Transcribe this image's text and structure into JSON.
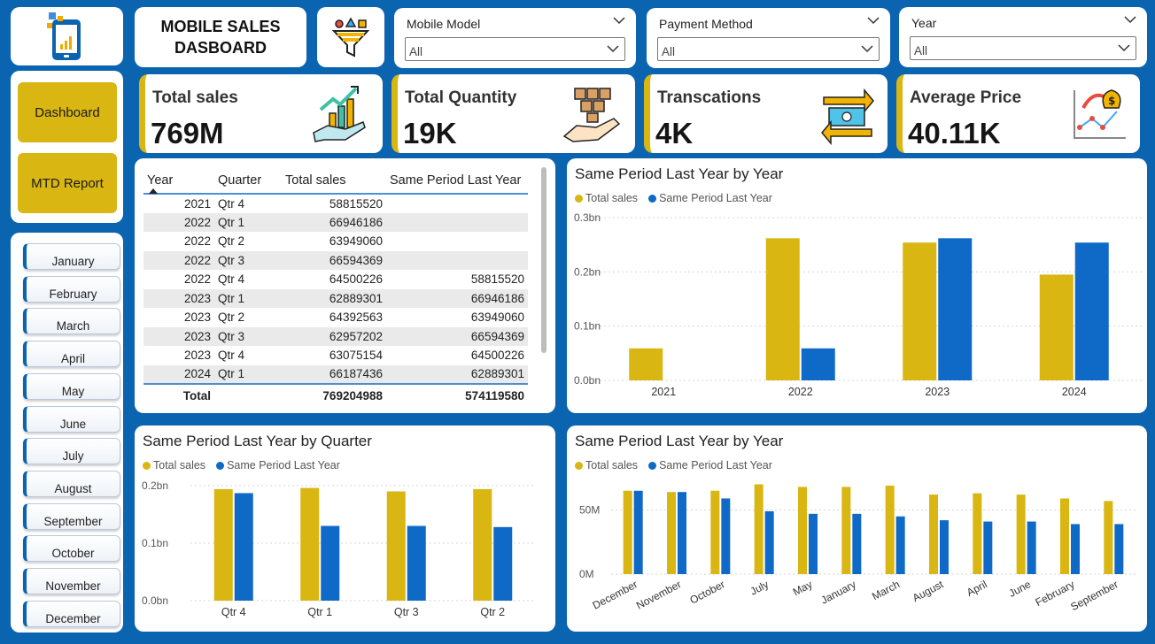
{
  "colors": {
    "accent": "#d9b611",
    "series_total": "#d9b611",
    "series_last": "#0f6ac7",
    "background": "#0a64b0"
  },
  "header": {
    "title": "MOBILE SALES\nDASBOARD"
  },
  "nav": {
    "dashboard": "Dashboard",
    "mtd": "MTD Report"
  },
  "months": [
    "January",
    "February",
    "March",
    "April",
    "May",
    "June",
    "July",
    "August",
    "September",
    "October",
    "November",
    "December"
  ],
  "slicers": [
    {
      "label": "Mobile Model",
      "value": "All"
    },
    {
      "label": "Payment Method",
      "value": "All"
    },
    {
      "label": "Year",
      "value": "All"
    }
  ],
  "kpis": [
    {
      "title": "Total sales",
      "value": "769M",
      "icon": "growth-chart-hand-icon"
    },
    {
      "title": "Total Quantity",
      "value": "19K",
      "icon": "boxes-hand-icon"
    },
    {
      "title": "Transcations",
      "value": "4K",
      "icon": "money-exchange-icon"
    },
    {
      "title": "Average Price",
      "value": "40.11K",
      "icon": "money-bag-chart-icon"
    }
  ],
  "table": {
    "headers": [
      "Year",
      "Quarter",
      "Total sales",
      "Same Period Last Year"
    ],
    "rows": [
      [
        "2021",
        "Qtr 4",
        "58815520",
        ""
      ],
      [
        "2022",
        "Qtr 1",
        "66946186",
        ""
      ],
      [
        "2022",
        "Qtr 2",
        "63949060",
        ""
      ],
      [
        "2022",
        "Qtr 3",
        "66594369",
        ""
      ],
      [
        "2022",
        "Qtr 4",
        "64500226",
        "58815520"
      ],
      [
        "2023",
        "Qtr 1",
        "62889301",
        "66946186"
      ],
      [
        "2023",
        "Qtr 2",
        "64392563",
        "63949060"
      ],
      [
        "2023",
        "Qtr 3",
        "62957202",
        "66594369"
      ],
      [
        "2023",
        "Qtr 4",
        "63075154",
        "64500226"
      ],
      [
        "2024",
        "Qtr 1",
        "66187436",
        "62889301"
      ]
    ],
    "total": [
      "Total",
      "",
      "769204988",
      "574119580"
    ]
  },
  "chart_data": [
    {
      "type": "bar",
      "title": "Same Period Last Year by Year",
      "categories": [
        "2021",
        "2022",
        "2023",
        "2024"
      ],
      "series": [
        {
          "name": "Total sales",
          "values": [
            0.059,
            0.262,
            0.254,
            0.195
          ]
        },
        {
          "name": "Same Period Last Year",
          "values": [
            0,
            0.059,
            0.262,
            0.254
          ]
        }
      ],
      "ylim": [
        0,
        0.3
      ],
      "yticks": [
        "0.0bn",
        "0.1bn",
        "0.2bn",
        "0.3bn"
      ],
      "ytick_values": [
        0,
        0.1,
        0.2,
        0.3
      ],
      "unit": "bn",
      "legend": "top-left",
      "grid": true
    },
    {
      "type": "bar",
      "title": "Same Period Last Year by Quarter",
      "categories": [
        "Qtr 4",
        "Qtr 1",
        "Qtr 3",
        "Qtr 2"
      ],
      "series": [
        {
          "name": "Total sales",
          "values": [
            0.194,
            0.196,
            0.19,
            0.194
          ]
        },
        {
          "name": "Same Period Last Year",
          "values": [
            0.187,
            0.13,
            0.13,
            0.128
          ]
        }
      ],
      "ylim": [
        0,
        0.2
      ],
      "yticks": [
        "0.0bn",
        "0.1bn",
        "0.2bn"
      ],
      "ytick_values": [
        0,
        0.1,
        0.2
      ],
      "unit": "bn",
      "legend": "top-left",
      "grid": true
    },
    {
      "type": "bar",
      "title": "Same Period Last Year by Year",
      "categories": [
        "December",
        "November",
        "October",
        "July",
        "May",
        "January",
        "March",
        "August",
        "April",
        "June",
        "February",
        "September"
      ],
      "series": [
        {
          "name": "Total sales",
          "values": [
            65,
            64,
            65,
            70,
            68,
            68,
            69,
            62,
            63,
            62,
            59,
            57
          ]
        },
        {
          "name": "Same Period Last Year",
          "values": [
            65,
            64,
            59,
            49,
            47,
            47,
            45,
            42,
            41,
            41,
            39,
            39
          ]
        }
      ],
      "ylim": [
        0,
        80
      ],
      "yticks": [
        "0M",
        "50M"
      ],
      "ytick_values": [
        0,
        50
      ],
      "unit": "M",
      "legend": "top-left",
      "grid": true,
      "xlabel_rotation": "diagonal"
    }
  ]
}
